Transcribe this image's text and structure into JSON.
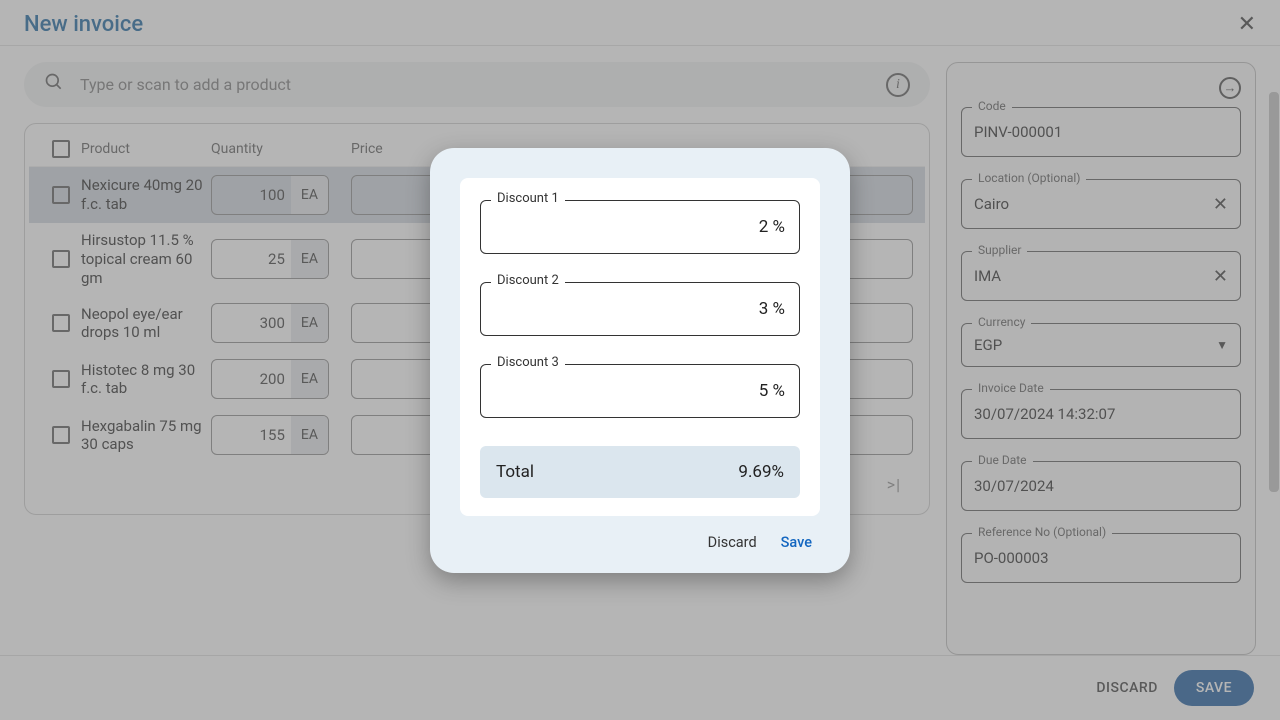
{
  "header": {
    "title": "New invoice"
  },
  "search": {
    "placeholder": "Type or scan to add a product"
  },
  "table": {
    "head": {
      "product": "Product",
      "quantity": "Quantity",
      "price": "Price"
    },
    "rows": [
      {
        "name": "Nexicure 40mg 20 f.c. tab",
        "qty": "100",
        "unit": "EA",
        "selected": true
      },
      {
        "name": "Hirsustop 11.5 % topical cream 60 gm",
        "qty": "25",
        "unit": "EA",
        "selected": false
      },
      {
        "name": "Neopol eye/ear drops 10 ml",
        "qty": "300",
        "unit": "EA",
        "selected": false
      },
      {
        "name": "Histotec 8 mg 30 f.c. tab",
        "qty": "200",
        "unit": "EA",
        "selected": false
      },
      {
        "name": "Hexgabalin 75 mg 30 caps",
        "qty": "155",
        "unit": "EA",
        "selected": false
      }
    ],
    "pager_last": ">|"
  },
  "side": {
    "code": {
      "label": "Code",
      "value": "PINV-000001"
    },
    "location": {
      "label": "Location (Optional)",
      "value": "Cairo"
    },
    "supplier": {
      "label": "Supplier",
      "value": "IMA"
    },
    "currency": {
      "label": "Currency",
      "value": "EGP"
    },
    "invoice_date": {
      "label": "Invoice Date",
      "value": "30/07/2024 14:32:07"
    },
    "due_date": {
      "label": "Due Date",
      "value": "30/07/2024"
    },
    "ref": {
      "label": "Reference No (Optional)",
      "value": "PO-000003"
    }
  },
  "footer": {
    "discard": "DISCARD",
    "save": "SAVE"
  },
  "modal": {
    "d1": {
      "label": "Discount 1",
      "value": "2 %"
    },
    "d2": {
      "label": "Discount 2",
      "value": "3 %"
    },
    "d3": {
      "label": "Discount 3",
      "value": "5 %"
    },
    "total_label": "Total",
    "total_value": "9.69%",
    "discard": "Discard",
    "save": "Save"
  }
}
